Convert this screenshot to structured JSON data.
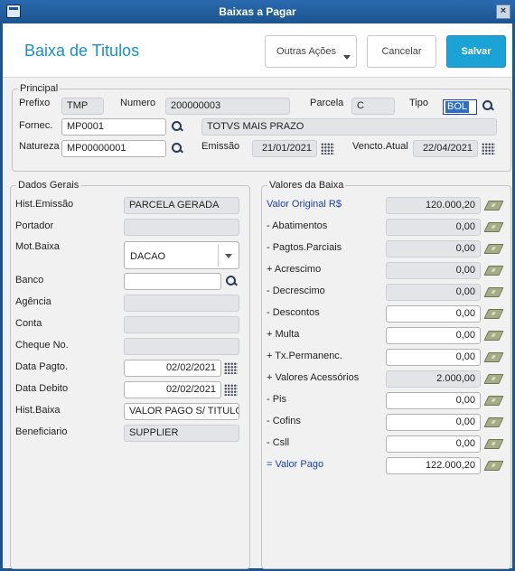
{
  "window": {
    "title": "Baixas a Pagar",
    "close": "×"
  },
  "header": {
    "title": "Baixa de Titulos",
    "btn_outras": "Outras Ações",
    "btn_cancelar": "Cancelar",
    "btn_salvar": "Salvar"
  },
  "principal": {
    "legend": "Principal",
    "prefixo_label": "Prefixo",
    "prefixo": "TMP",
    "numero_label": "Numero",
    "numero": "200000003",
    "parcela_label": "Parcela",
    "parcela": "C",
    "tipo_label": "Tipo",
    "tipo": "BOL",
    "fornec_label": "Fornec.",
    "fornec": "MP0001",
    "fornec_nome": "TOTVS MAIS PRAZO",
    "natureza_label": "Natureza",
    "natureza": "MP00000001",
    "emissao_label": "Emissão",
    "emissao": "21/01/2021",
    "vencto_label": "Vencto.Atual",
    "vencto": "22/04/2021"
  },
  "dados": {
    "legend": "Dados Gerais",
    "hist_emissao_label": "Hist.Emissão",
    "hist_emissao": "PARCELA GERADA",
    "portador_label": "Portador",
    "portador": "",
    "mot_baixa_label": "Mot.Baixa",
    "mot_baixa": "DACAO",
    "banco_label": "Banco",
    "banco": "",
    "agencia_label": "Agência",
    "agencia": "",
    "conta_label": "Conta",
    "conta": "",
    "cheque_label": "Cheque No.",
    "cheque": "",
    "data_pagto_label": "Data Pagto.",
    "data_pagto": "02/02/2021",
    "data_debito_label": "Data Debito",
    "data_debito": "02/02/2021",
    "hist_baixa_label": "Hist.Baixa",
    "hist_baixa": "VALOR PAGO S/ TITULO",
    "beneficiario_label": "Beneficiario",
    "beneficiario": "SUPPLIER"
  },
  "valores": {
    "legend": "Valores da Baixa",
    "items": [
      {
        "label": "Valor Original R$",
        "value": "120.000,20"
      },
      {
        "label": "- Abatimentos",
        "value": "0,00"
      },
      {
        "label": "- Pagtos.Parciais",
        "value": "0,00"
      },
      {
        "label": "+ Acrescimo",
        "value": "0,00"
      },
      {
        "label": "- Decrescimo",
        "value": "0,00"
      },
      {
        "label": "- Descontos",
        "value": "0,00"
      },
      {
        "label": "+ Multa",
        "value": "0,00"
      },
      {
        "label": "+ Tx.Permanenc.",
        "value": "0,00"
      },
      {
        "label": "+ Valores Acessórios",
        "value": "2.000,00"
      },
      {
        "label": "- Pis",
        "value": "0,00"
      },
      {
        "label": "- Cofins",
        "value": "0,00"
      },
      {
        "label": "- Csll",
        "value": "0,00"
      },
      {
        "label": "= Valor Pago",
        "value": "122.000,20"
      }
    ]
  }
}
